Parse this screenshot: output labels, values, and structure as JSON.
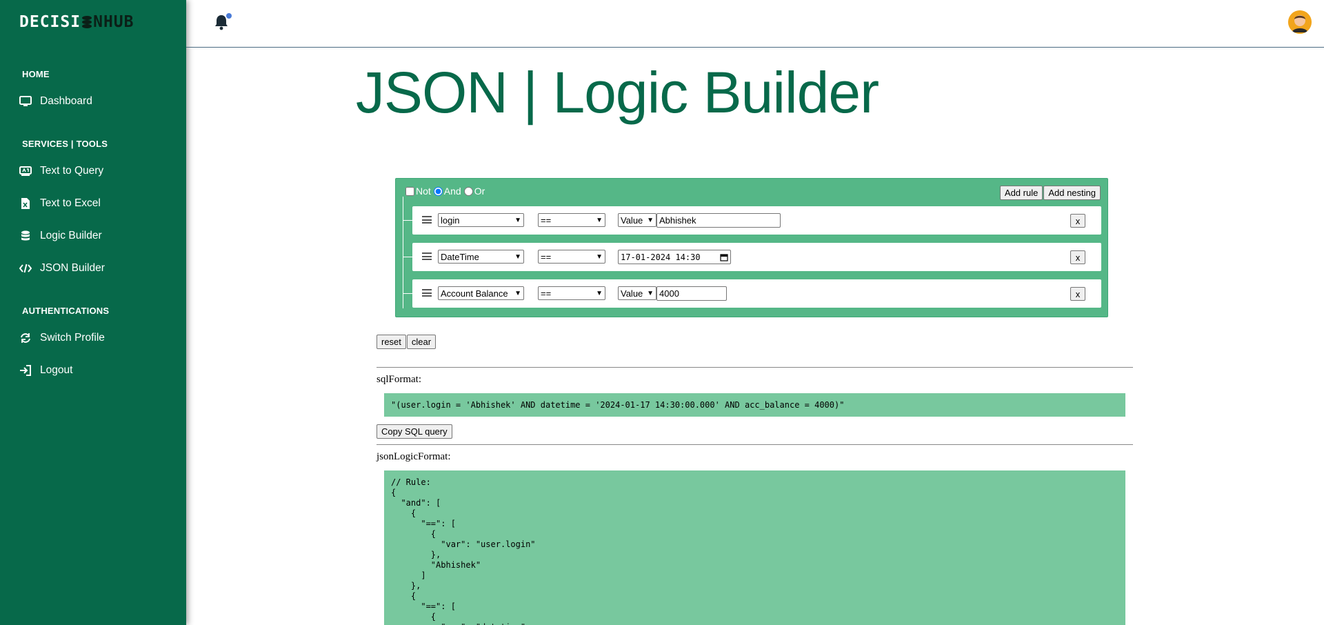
{
  "brand": {
    "part1": "DECISI",
    "part2": "N",
    "part3": "HUB"
  },
  "sidebar": {
    "sections": [
      {
        "title": "HOME",
        "items": [
          {
            "label": "Dashboard",
            "icon": "monitor-icon"
          }
        ]
      },
      {
        "title": "SERVICES | TOOLS",
        "items": [
          {
            "label": "Text to Query",
            "icon": "query-icon"
          },
          {
            "label": "Text to Excel",
            "icon": "excel-icon"
          },
          {
            "label": "Logic Builder",
            "icon": "database-icon"
          },
          {
            "label": "JSON Builder",
            "icon": "code-icon"
          }
        ]
      },
      {
        "title": "AUTHENTICATIONS",
        "items": [
          {
            "label": "Switch Profile",
            "icon": "switch-icon"
          },
          {
            "label": "Logout",
            "icon": "logout-icon"
          }
        ]
      }
    ]
  },
  "page": {
    "title": "JSON | Logic Builder"
  },
  "builder": {
    "not_label": "Not",
    "and_label": "And",
    "or_label": "Or",
    "add_rule": "Add rule",
    "add_nesting": "Add nesting",
    "rules": [
      {
        "field": "login",
        "operator": "==",
        "value_source": "Value",
        "value": "Abhishek"
      },
      {
        "field": "DateTime",
        "operator": "==",
        "value": "17-01-2024 14:30"
      },
      {
        "field": "Account Balance",
        "operator": "==",
        "value_source": "Value",
        "value": "4000"
      }
    ],
    "remove_label": "x"
  },
  "actions": {
    "reset": "reset",
    "clear": "clear",
    "copy_sql": "Copy SQL query"
  },
  "output": {
    "sql_label": "sqlFormat:",
    "sql_value": "\"(user.login = 'Abhishek' AND datetime = '2024-01-17 14:30:00.000' AND acc_balance = 4000)\"",
    "json_label": "jsonLogicFormat:",
    "json_value": "// Rule:\n{\n  \"and\": [\n    {\n      \"==\": [\n        {\n          \"var\": \"user.login\"\n        },\n        \"Abhishek\"\n      ]\n    },\n    {\n      \"==\": [\n        {\n          \"var\": \"datetime\""
  },
  "colors": {
    "primary": "#07694a",
    "builder_bg": "#55b787",
    "output_bg": "#78c89e",
    "notification_dot": "#4a7bd8"
  }
}
